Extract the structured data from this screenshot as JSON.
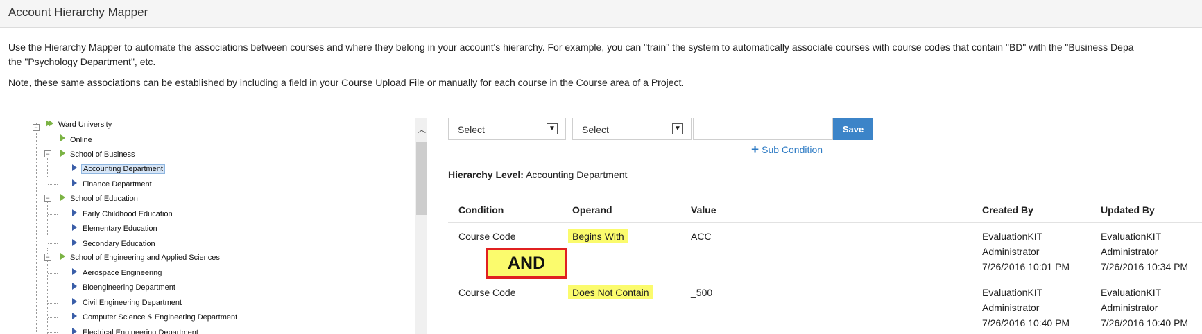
{
  "header": {
    "title": "Account Hierarchy Mapper"
  },
  "intro": {
    "p1_line1": "Use the Hierarchy Mapper to automate the associations between courses and where they belong in your account's hierarchy. For example, you can \"train\" the system to automatically associate courses with course codes that contain \"BD\" with the \"Business Depa",
    "p1_line2": "the \"Psychology Department\", etc.",
    "p2": "Note, these same associations can be established by including a field in your Course Upload File or manually for each course in the Course area of a Project."
  },
  "tree": {
    "root": "Ward University",
    "online": "Online",
    "business": "School of Business",
    "accounting": "Accounting Department",
    "finance": "Finance Department",
    "education": "School of Education",
    "early": "Early Childhood Education",
    "elementary": "Elementary Education",
    "secondary": "Secondary Education",
    "engineering": "School of Engineering and Applied Sciences",
    "aerospace": "Aerospace Engineering",
    "bio": "Bioengineering Department",
    "civil": "Civil Engineering Department",
    "cs": "Computer Science & Engineering Department",
    "electrical": "Electrical Engineering Department"
  },
  "builder": {
    "condition_select": "Select",
    "operand_select": "Select",
    "save_label": "Save",
    "sub_condition_label": "Sub Condition"
  },
  "hierarchy_level": {
    "label": "Hierarchy Level:",
    "value": "Accounting Department"
  },
  "table": {
    "headers": {
      "condition": "Condition",
      "operand": "Operand",
      "value": "Value",
      "created_by": "Created By",
      "updated_by": "Updated By"
    },
    "rows": [
      {
        "condition": "Course Code",
        "operand": "Begins With",
        "value": "ACC",
        "created_name1": "EvaluationKIT",
        "created_name2": "Administrator",
        "created_date": "7/26/2016 10:01 PM",
        "updated_name1": "EvaluationKIT",
        "updated_name2": "Administrator",
        "updated_date": "7/26/2016 10:34 PM"
      },
      {
        "condition": "Course Code",
        "operand": "Does Not Contain",
        "value": "_500",
        "created_name1": "EvaluationKIT",
        "created_name2": "Administrator",
        "created_date": "7/26/2016 10:40 PM",
        "updated_name1": "EvaluationKIT",
        "updated_name2": "Administrator",
        "updated_date": "7/26/2016 10:40 PM"
      }
    ],
    "joiner": "AND"
  },
  "colors": {
    "accent": "#3c84c8",
    "highlight": "#fbfb6d",
    "and_border": "#e02020",
    "tree_green": "#7bb344",
    "tree_blue": "#3a5ea8"
  }
}
